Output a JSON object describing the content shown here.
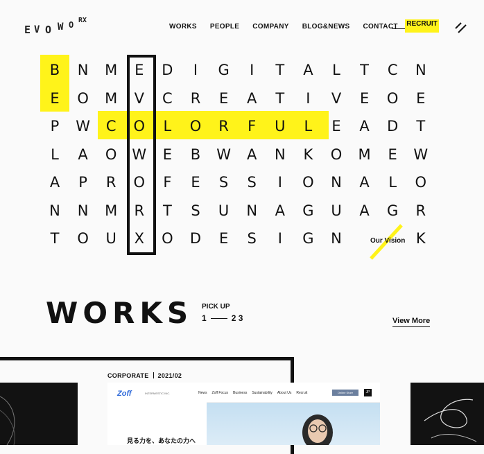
{
  "header": {
    "logo_letters": [
      "E",
      "V",
      "O",
      "W",
      "O",
      "RX"
    ],
    "nav": [
      "WORKS",
      "PEOPLE",
      "COMPANY",
      "BLOG&NEWS",
      "CONTACT"
    ],
    "recruit": "RECRUIT",
    "menu_icon": "menu-slashes-icon"
  },
  "grid": {
    "rows": [
      [
        "B",
        "N",
        "M",
        "E",
        "D",
        "I",
        "G",
        "I",
        "T",
        "A",
        "L",
        "T",
        "C",
        "N"
      ],
      [
        "E",
        "O",
        "M",
        "V",
        "C",
        "R",
        "E",
        "A",
        "T",
        "I",
        "V",
        "E",
        "O",
        "E"
      ],
      [
        "P",
        "W",
        "C",
        "O",
        "L",
        "O",
        "R",
        "F",
        "U",
        "L",
        "E",
        "A",
        "D",
        "T"
      ],
      [
        "L",
        "A",
        "O",
        "W",
        "E",
        "B",
        "W",
        "A",
        "N",
        "K",
        "O",
        "M",
        "E",
        "W"
      ],
      [
        "A",
        "P",
        "R",
        "O",
        "F",
        "E",
        "S",
        "S",
        "I",
        "O",
        "N",
        "A",
        "L",
        "O"
      ],
      [
        "N",
        "N",
        "M",
        "R",
        "T",
        "S",
        "U",
        "N",
        "A",
        "G",
        "U",
        "A",
        "G",
        "R"
      ],
      [
        "T",
        "O",
        "U",
        "X",
        "O",
        "D",
        "E",
        "S",
        "I",
        "G",
        "N",
        "",
        "",
        "K"
      ]
    ],
    "our_vision": "Our Vision",
    "highlight_color": "#fff31a"
  },
  "works": {
    "title": "WORKS",
    "pickup": "PICK UP",
    "pager_current": "1",
    "pager_rest": "2 3",
    "view_more": "View More"
  },
  "card": {
    "category": "CORPORATE",
    "date": "2021/02",
    "site_logo": "Zoff",
    "site_sub": "INTERMESTIC INC.",
    "site_nav": [
      "News",
      "Zoff Focus",
      "Business",
      "Sustainability",
      "About Us",
      "Recruit"
    ],
    "site_button": "Online Store",
    "site_copy": "見る力を、あなたの力へ"
  }
}
